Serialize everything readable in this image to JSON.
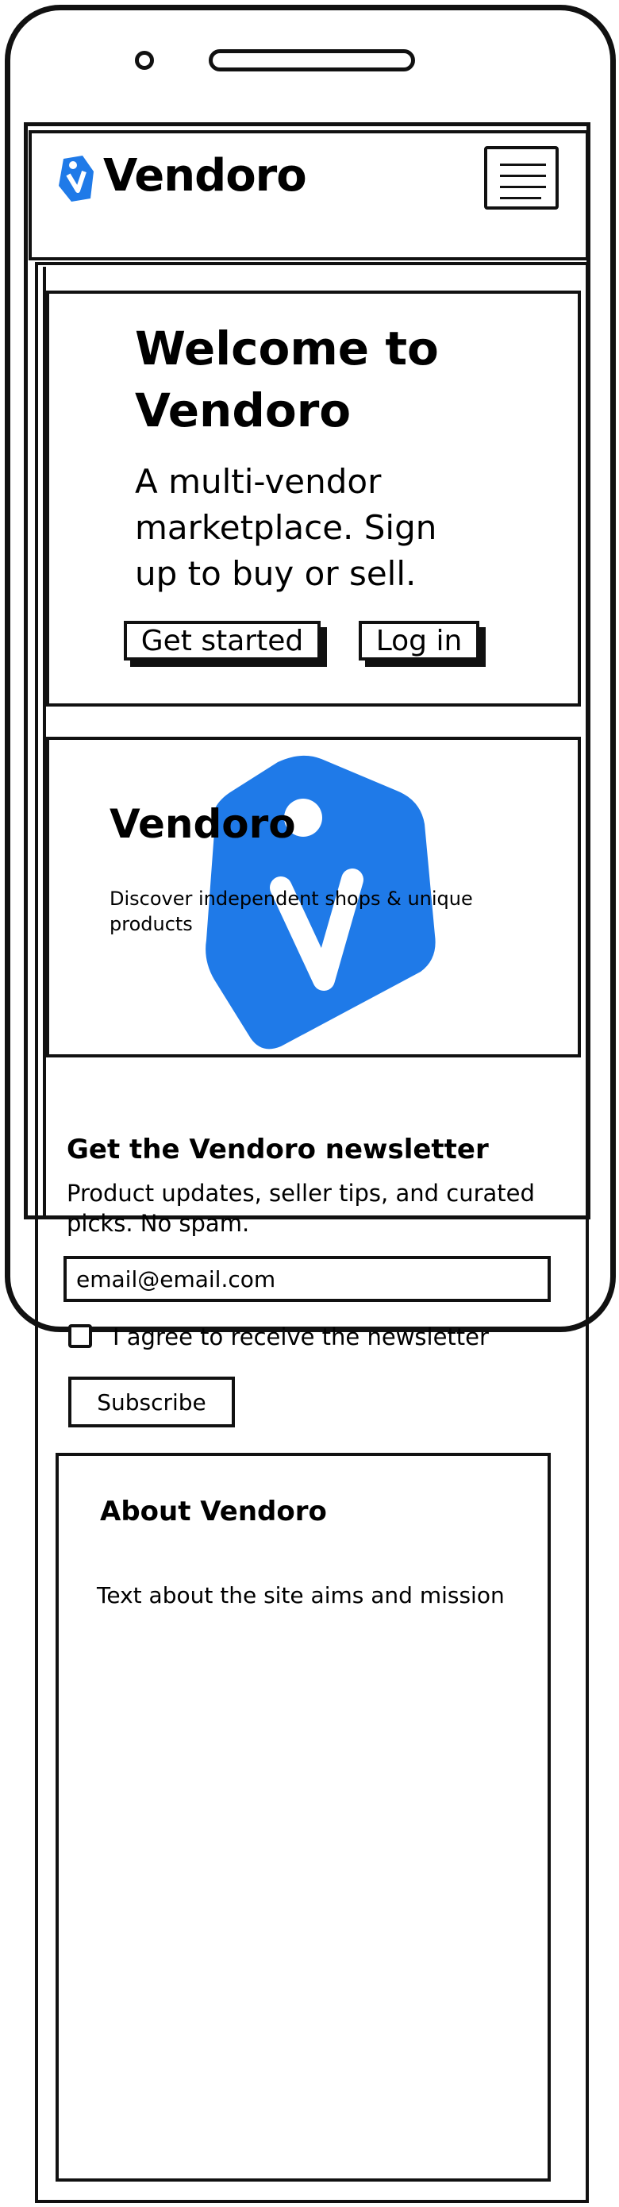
{
  "header": {
    "brand": "Vendoro",
    "logo_icon": "tag-v-icon",
    "menu_icon": "hamburger-menu-icon"
  },
  "hero": {
    "title": "Welcome to Vendoro",
    "subtitle": "A multi-vendor marketplace. Sign up to buy or sell.",
    "primary_button": "Get started",
    "secondary_button": "Log in"
  },
  "promo": {
    "title": "Vendoro",
    "subtitle": "Discover independent shops & unique products",
    "image_icon": "tag-v-icon"
  },
  "newsletter": {
    "title": "Get the Vendoro newsletter",
    "description": "Product updates, seller tips, and curated picks. No spam.",
    "email_value": "email@email.com",
    "agree_label": "I agree to receive the newsletter",
    "agree_checked": false,
    "subscribe_button": "Subscribe"
  },
  "about": {
    "title": "About Vendoro",
    "text": "Text about the site aims and mission"
  },
  "colors": {
    "brand_blue": "#1f7ae8",
    "ink": "#111111",
    "background": "#ffffff"
  }
}
